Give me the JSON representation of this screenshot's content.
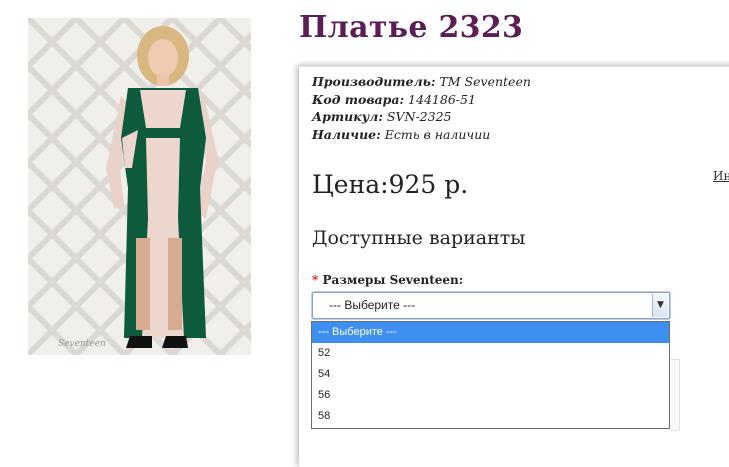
{
  "product": {
    "title": "Платье 2323"
  },
  "details": [
    {
      "label": "Производитель:",
      "value": " TM Seventeen"
    },
    {
      "label": "Код товара:",
      "value": " 144186-51"
    },
    {
      "label": "Артикул:",
      "value": " SVN-2325"
    },
    {
      "label": "Наличие:",
      "value": " Есть в наличии"
    }
  ],
  "price": {
    "label": "Цена:",
    "value": "925 р."
  },
  "side_link": "Ин",
  "variants": {
    "heading": "Доступные варианты",
    "required_mark": "*",
    "size_label": "Размеры Seventeen:",
    "selected": "--- Выберите ---",
    "arrow_icon": "▼",
    "options": [
      "--- Выберите ---",
      "52",
      "54",
      "56",
      "58"
    ]
  },
  "image": {
    "watermark": "Seventeen"
  },
  "colors": {
    "title": "#5b1d55",
    "dress_green": "#0e5a3c",
    "dress_beige": "#ecd6cd",
    "option_highlight": "#3d8ff0"
  }
}
